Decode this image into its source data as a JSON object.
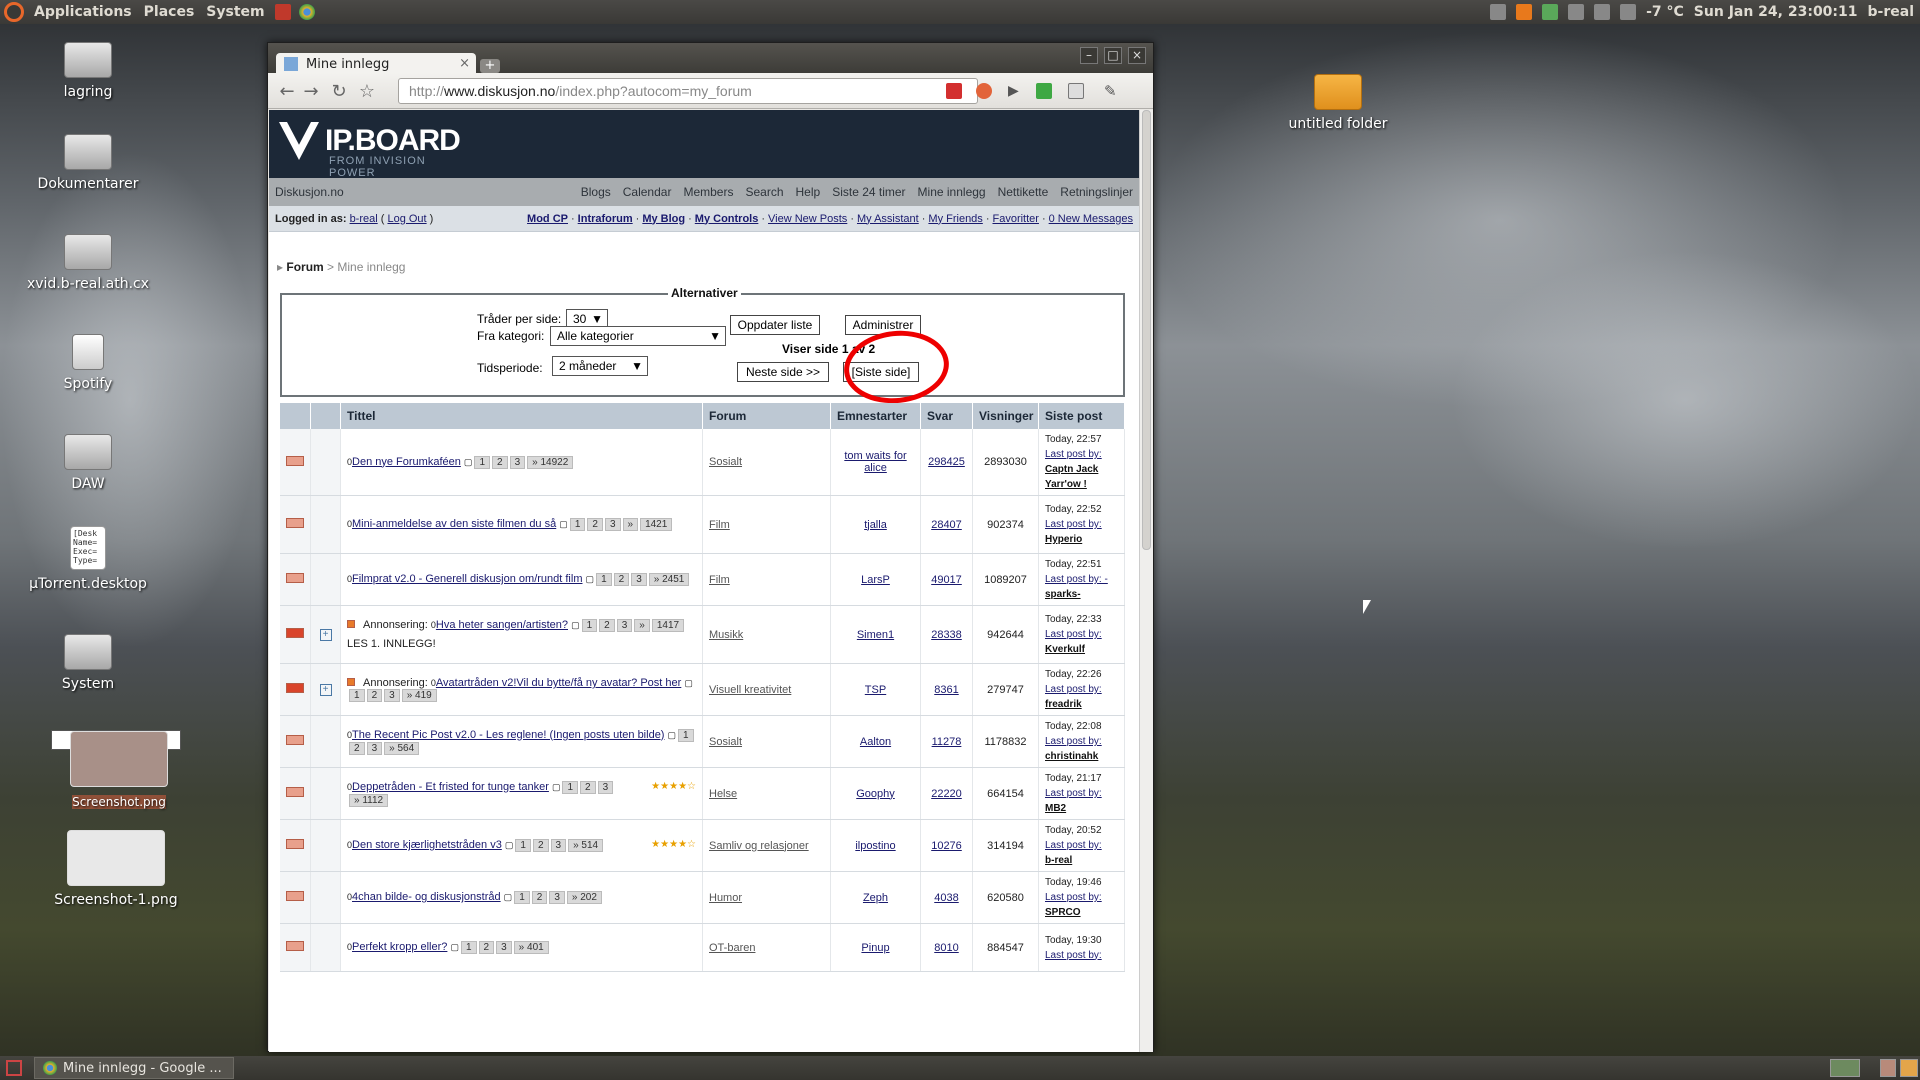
{
  "panel": {
    "menus": [
      "Applications",
      "Places",
      "System"
    ],
    "weather": "-7 °C",
    "clock": "Sun Jan 24, 23:00:11",
    "user": "b-real"
  },
  "desktop": {
    "icons": [
      {
        "label": "lagring"
      },
      {
        "label": "Dokumentarer"
      },
      {
        "label": "xvid.b-real.ath.cx"
      },
      {
        "label": "Spotify"
      },
      {
        "label": "DAW"
      },
      {
        "label": "µTorrent.desktop"
      },
      {
        "label": "System"
      },
      {
        "label": "Screenshot.png"
      },
      {
        "label": "Screenshot-1.png"
      },
      {
        "label": "untitled folder"
      }
    ],
    "desktop_file_preview": "[Desk\nName=\nExec=\nType="
  },
  "taskbar": {
    "window_label": "Mine innlegg - Google ..."
  },
  "browser": {
    "tab_title": "Mine innlegg",
    "url_prefix": "http://",
    "url_host": "www.diskusjon.no",
    "url_path": "/index.php?autocom=my_forum"
  },
  "site": {
    "logo": "IP.BOARD",
    "logo_sub": "FROM INVISION POWER",
    "name": "Diskusjon.no",
    "nav": [
      "Blogs",
      "Calendar",
      "Members",
      "Search",
      "Help",
      "Siste 24 timer",
      "Mine innlegg",
      "Nettikette",
      "Retningslinjer"
    ],
    "logged_in_as": "Logged in as:",
    "username": "b-real",
    "logout": "Log Out",
    "user_links": [
      "Mod CP",
      "Intraforum",
      "My Blog",
      "My Controls",
      "View New Posts",
      "My Assistant",
      "My Friends",
      "Favoritter",
      "0 New Messages"
    ],
    "breadcrumb_root": "Forum",
    "breadcrumb_current": "> Mine innlegg"
  },
  "alternativer": {
    "legend": "Alternativer",
    "threads_label": "Tråder per side:",
    "threads_value": "30",
    "category_label": "Fra kategori:",
    "category_value": "Alle kategorier",
    "period_label": "Tidsperiode:",
    "period_value": "2 måneder",
    "update_button": "Oppdater liste",
    "admin_button": "Administrer",
    "page_status": "Viser side 1 av 2",
    "next_button": "Neste side >>",
    "last_button": "[Siste side]"
  },
  "table": {
    "headers": [
      "Tittel",
      "Forum",
      "Emnestarter",
      "Svar",
      "Visninger",
      "Siste post"
    ],
    "rows": [
      {
        "title": "Den nye Forumkaféen",
        "pages": [
          "1",
          "2",
          "3",
          "» 14922"
        ],
        "forum": "Sosialt",
        "starter": "tom waits for alice",
        "replies": "298425",
        "views": "2893030",
        "time": "Today, 22:57",
        "lastby_label": "Last post by:",
        "lastby": "Captn Jack Yarr'ow !"
      },
      {
        "title": "Mini-anmeldelse av den siste filmen du så",
        "pages": [
          "1",
          "2",
          "3",
          "»",
          "1421"
        ],
        "forum": "Film",
        "starter": "tjalla",
        "replies": "28407",
        "views": "902374",
        "time": "Today, 22:52",
        "lastby_label": "Last post by:",
        "lastby": "Hyperio"
      },
      {
        "title": "Filmprat v2.0 - Generell diskusjon om/rundt film",
        "pages": [
          "1",
          "2",
          "3",
          "» 2451"
        ],
        "forum": "Film",
        "starter": "LarsP",
        "replies": "49017",
        "views": "1089207",
        "time": "Today, 22:51",
        "lastby_label": "Last post by: -",
        "lastby": "sparks-"
      },
      {
        "title": "Hva heter sangen/artisten?",
        "prefix": "Annonsering:",
        "pages": [
          "1",
          "2",
          "3",
          "»",
          "1417"
        ],
        "note": "LES 1. INNLEGG!",
        "forum": "Musikk",
        "starter": "Simen1",
        "replies": "28338",
        "views": "942644",
        "time": "Today, 22:33",
        "lastby_label": "Last post by:",
        "lastby": "Kverkulf"
      },
      {
        "title": "Avatartråden v2!Vil du bytte/få ny avatar? Post her",
        "prefix": "Annonsering:",
        "pages": [
          "1",
          "2",
          "3",
          "» 419"
        ],
        "forum": "Visuell kreativitet",
        "starter": "TSP",
        "replies": "8361",
        "views": "279747",
        "time": "Today, 22:26",
        "lastby_label": "Last post by:",
        "lastby": "freadrik"
      },
      {
        "title": "The Recent Pic Post v2.0 - Les reglene! (Ingen posts uten bilde)",
        "pages": [
          "1",
          "2",
          "3",
          "» 564"
        ],
        "forum": "Sosialt",
        "starter": "Aalton",
        "replies": "11278",
        "views": "1178832",
        "time": "Today, 22:08",
        "lastby_label": "Last post by:",
        "lastby": "christinahk"
      },
      {
        "title": "Deppetråden - Et fristed for tunge tanker",
        "pages": [
          "1",
          "2",
          "3",
          "» 1112"
        ],
        "stars": "★★★★☆",
        "forum": "Helse",
        "starter": "Goophy",
        "replies": "22220",
        "views": "664154",
        "time": "Today, 21:17",
        "lastby_label": "Last post by:",
        "lastby": "MB2"
      },
      {
        "title": "Den store kjærlighetstråden v3",
        "pages": [
          "1",
          "2",
          "3",
          "» 514"
        ],
        "stars": "★★★★☆",
        "forum": "Samliv og relasjoner",
        "starter": "ilpostino",
        "replies": "10276",
        "views": "314194",
        "time": "Today, 20:52",
        "lastby_label": "Last post by:",
        "lastby": "b-real"
      },
      {
        "title": "4chan bilde- og diskusjonstråd",
        "pages": [
          "1",
          "2",
          "3",
          "» 202"
        ],
        "forum": "Humor",
        "starter": "Zeph",
        "replies": "4038",
        "views": "620580",
        "time": "Today, 19:46",
        "lastby_label": "Last post by:",
        "lastby": "SPRCO"
      },
      {
        "title": "Perfekt kropp eller?",
        "pages": [
          "1",
          "2",
          "3",
          "» 401"
        ],
        "forum": "OT-baren",
        "starter": "Pinup",
        "replies": "8010",
        "views": "884547",
        "time": "Today, 19:30",
        "lastby_label": "Last post by:",
        "lastby": ""
      }
    ]
  }
}
